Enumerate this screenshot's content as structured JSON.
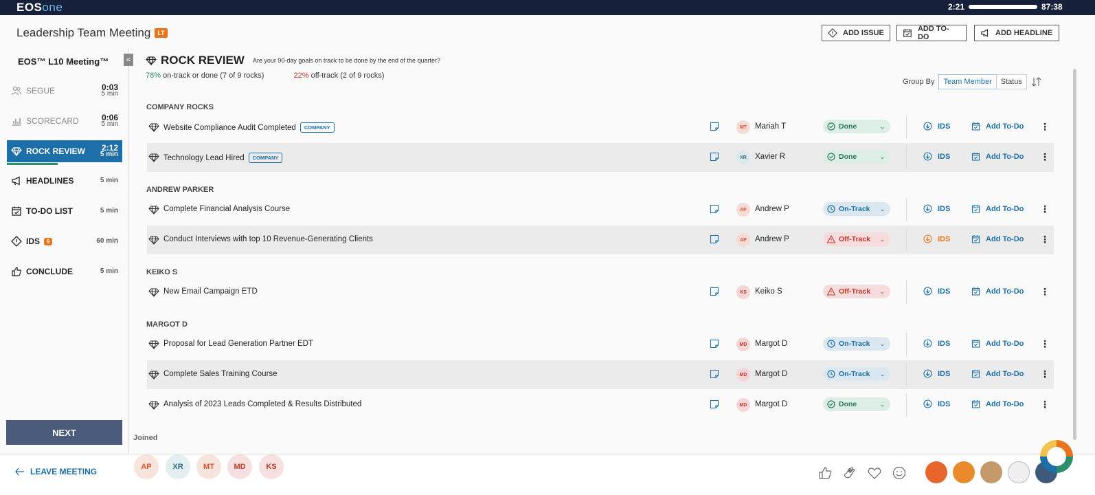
{
  "topbar": {
    "logo_a": "EOS",
    "logo_b": "one",
    "time_left": "2:21",
    "time_right": "87:38",
    "progress": 0.97
  },
  "header": {
    "title": "Leadership Team Meeting",
    "badge": "LT",
    "add_issue": "ADD ISSUE",
    "add_todo": "ADD TO-DO",
    "add_headline": "ADD HEADLINE"
  },
  "sidebar": {
    "title": "EOS™ L10 Meeting™",
    "collapse": "«",
    "items": [
      {
        "label": "SEGUE",
        "time": "0:03",
        "mins": "5 min",
        "icon": "people-icon"
      },
      {
        "label": "SCORECARD",
        "time": "0:06",
        "mins": "5 min",
        "icon": "chart-icon"
      },
      {
        "label": "ROCK REVIEW",
        "time": "2:12",
        "mins": "5 min",
        "icon": "gem-icon"
      },
      {
        "label": "HEADLINES",
        "mins": "5 min",
        "icon": "megaphone-icon"
      },
      {
        "label": "TO-DO LIST",
        "mins": "5 min",
        "icon": "calendar-check-icon"
      },
      {
        "label": "IDS",
        "badge": "9",
        "mins": "60 min",
        "icon": "diamond-icon"
      },
      {
        "label": "CONCLUDE",
        "mins": "5 min",
        "icon": "thumbs-up-icon"
      }
    ],
    "next": "NEXT"
  },
  "main": {
    "title": "ROCK REVIEW",
    "subtitle": "Are your 90-day goals on track to be done by the end of the quarter?",
    "ontrack_pct": "78%",
    "ontrack_text": "on-track or done (7 of 9 rocks)",
    "offtrack_pct": "22%",
    "offtrack_text": "off-track (2 of 9 rocks)",
    "group_by_label": "Group By",
    "group_by_options": [
      "Team Member",
      "Status"
    ],
    "group_by_selected": "Team Member",
    "ids_label": "IDS",
    "add_todo_label": "Add To-Do",
    "groups": [
      {
        "name": "COMPANY ROCKS",
        "rows": [
          {
            "title": "Website Compliance Audit Completed",
            "badge": "COMPANY",
            "initials": "MT",
            "owner": "Mariah T",
            "status": "Done"
          },
          {
            "title": "Technology Lead Hired",
            "badge": "COMPANY",
            "initials": "XR",
            "owner": "Xavier R",
            "status": "Done"
          }
        ]
      },
      {
        "name": "ANDREW PARKER",
        "rows": [
          {
            "title": "Complete Financial Analysis Course",
            "initials": "AP",
            "owner": "Andrew P",
            "status": "On-Track"
          },
          {
            "title": "Conduct Interviews with top 10 Revenue-Generating Clients",
            "initials": "AP",
            "owner": "Andrew P",
            "status": "Off-Track"
          }
        ]
      },
      {
        "name": "KEIKO S",
        "rows": [
          {
            "title": "New Email Campaign ETD",
            "initials": "KS",
            "owner": "Keiko S",
            "status": "Off-Track"
          }
        ]
      },
      {
        "name": "MARGOT D",
        "rows": [
          {
            "title": "Proposal for Lead Generation Partner EDT",
            "initials": "MD",
            "owner": "Margot D",
            "status": "On-Track"
          },
          {
            "title": "Complete Sales Training Course",
            "initials": "MD",
            "owner": "Margot D",
            "status": "On-Track"
          },
          {
            "title": "Analysis of 2023 Leads Completed & Results Distributed",
            "initials": "MD",
            "owner": "Margot D",
            "status": "Done"
          }
        ]
      }
    ]
  },
  "footer": {
    "joined": "Joined",
    "attendees": [
      "AP",
      "XR",
      "MT",
      "MD",
      "KS"
    ],
    "leave": "LEAVE MEETING"
  },
  "colors": {
    "accent": "#1c6fa8",
    "orange": "#e8741c",
    "green": "#2a8f6a",
    "red": "#c0392b",
    "topbar": "#16203a"
  }
}
